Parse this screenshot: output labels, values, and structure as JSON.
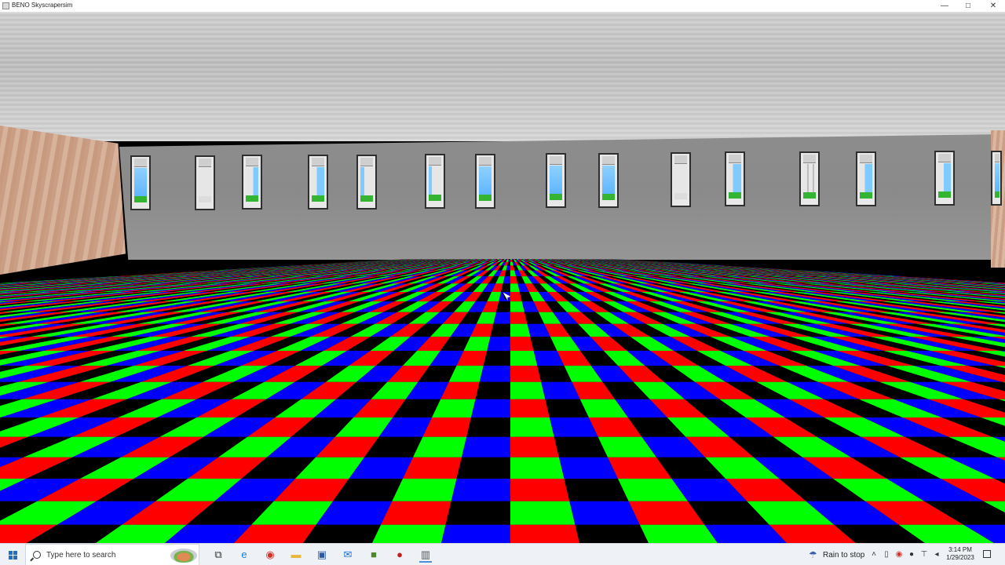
{
  "window": {
    "title": "BENO Skyscrapersim",
    "min_symbol": "—",
    "max_symbol": "□",
    "close_symbol": "✕"
  },
  "scene": {
    "floor_colors": [
      "#00ff00",
      "#0000ff",
      "#ff0000",
      "#000000"
    ],
    "wall_color": "#8d8d8d",
    "ceiling_color": "#c8c8c8"
  },
  "taskbar": {
    "search_placeholder": "Type here to search",
    "pinned": [
      {
        "name": "task-view-icon",
        "glyph": "⧉",
        "color": "#333333"
      },
      {
        "name": "edge-icon",
        "glyph": "e",
        "color": "#1a7fd6"
      },
      {
        "name": "chrome-icon",
        "glyph": "◉",
        "color": "#d93025"
      },
      {
        "name": "file-explorer-icon",
        "glyph": "▬",
        "color": "#e8b83a"
      },
      {
        "name": "store-icon",
        "glyph": "▣",
        "color": "#2a5aa8"
      },
      {
        "name": "mail-icon",
        "glyph": "✉",
        "color": "#1a6fd0"
      },
      {
        "name": "minecraft-icon",
        "glyph": "■",
        "color": "#4a8a2a"
      },
      {
        "name": "app-red-icon",
        "glyph": "●",
        "color": "#c0201f"
      },
      {
        "name": "skyscrapersim-icon",
        "glyph": "▥",
        "color": "#555555"
      }
    ],
    "weather": "Rain to stop",
    "time": "3:14 PM",
    "date": "1/29/2023"
  }
}
